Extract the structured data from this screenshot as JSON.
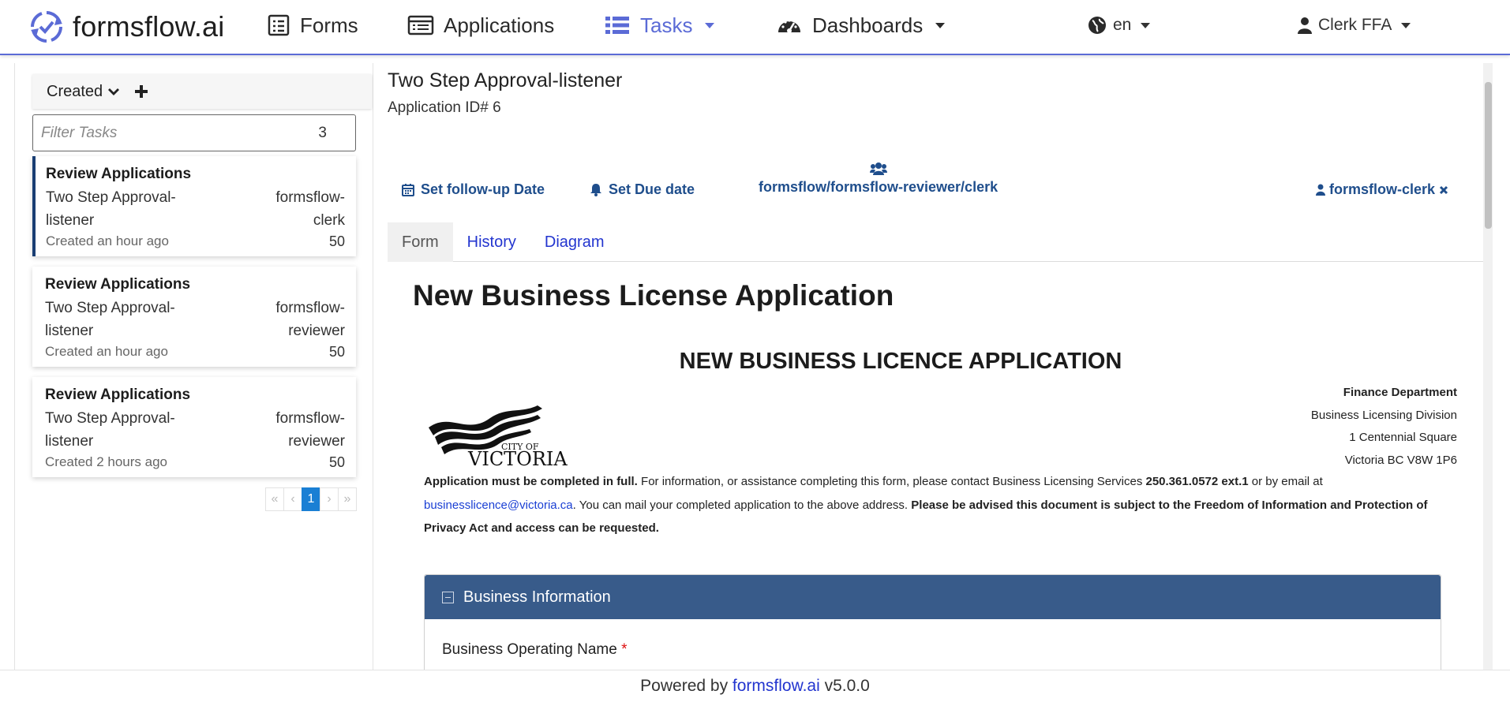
{
  "nav": {
    "brand": "formsflow.ai",
    "items": [
      {
        "label": "Forms",
        "icon": "forms-icon"
      },
      {
        "label": "Applications",
        "icon": "applications-icon"
      },
      {
        "label": "Tasks",
        "icon": "tasks-icon"
      },
      {
        "label": "Dashboards",
        "icon": "dashboards-icon"
      }
    ],
    "language": "en",
    "user": "Clerk FFA",
    "accent_color": "#5b6bd6"
  },
  "tasks_panel": {
    "sort_label": "Created",
    "filter_placeholder": "Filter Tasks",
    "filter_count": "3",
    "tasks": [
      {
        "title": "Review Applications",
        "name": "Two Step Approval-listener",
        "assignee": "formsflow-clerk",
        "created": "Created an hour ago",
        "priority": "50"
      },
      {
        "title": "Review Applications",
        "name": "Two Step Approval-listener",
        "assignee": "formsflow-reviewer",
        "created": "Created an hour ago",
        "priority": "50"
      },
      {
        "title": "Review Applications",
        "name": "Two Step Approval-listener",
        "assignee": "formsflow-reviewer",
        "created": "Created 2 hours ago",
        "priority": "50"
      }
    ],
    "pager": {
      "first": "«",
      "prev": "‹",
      "current": "1",
      "next": "›",
      "last": "»"
    }
  },
  "detail": {
    "title": "Two Step Approval-listener",
    "app_id": "Application ID# 6",
    "follow_up": "Set follow-up Date",
    "due_date": "Set Due date",
    "groups": "formsflow/formsflow-reviewer/clerk",
    "assignee": "formsflow-clerk",
    "tabs": [
      "Form",
      "History",
      "Diagram"
    ]
  },
  "form": {
    "heading": "New Business License Application",
    "subheading": "NEW BUSINESS LICENCE APPLICATION",
    "logo_text": "CITY OF VICTORIA",
    "address": {
      "dept": "Finance Department",
      "division": "Business Licensing Division",
      "street": "1 Centennial Square",
      "city": "Victoria BC V8W 1P6"
    },
    "notice": {
      "bold1": "Application must be completed in full.",
      "text1": " For information, or assistance completing this form, please contact Business Licensing Services ",
      "phone": "250.361.0572 ext.1",
      "text2": " or by email at ",
      "email": "businesslicence@victoria.ca",
      "text3": ". You can mail your completed application to the above address. ",
      "bold2": "Please be advised this document is subject to the Freedom of Information and Protection of Privacy Act and access can be requested."
    },
    "section_title": "Business Information",
    "field_label": "Business Operating Name",
    "required_mark": "*"
  },
  "footer": {
    "prefix": "Powered by ",
    "link": "formsflow.ai",
    "version": " v5.0.0"
  }
}
